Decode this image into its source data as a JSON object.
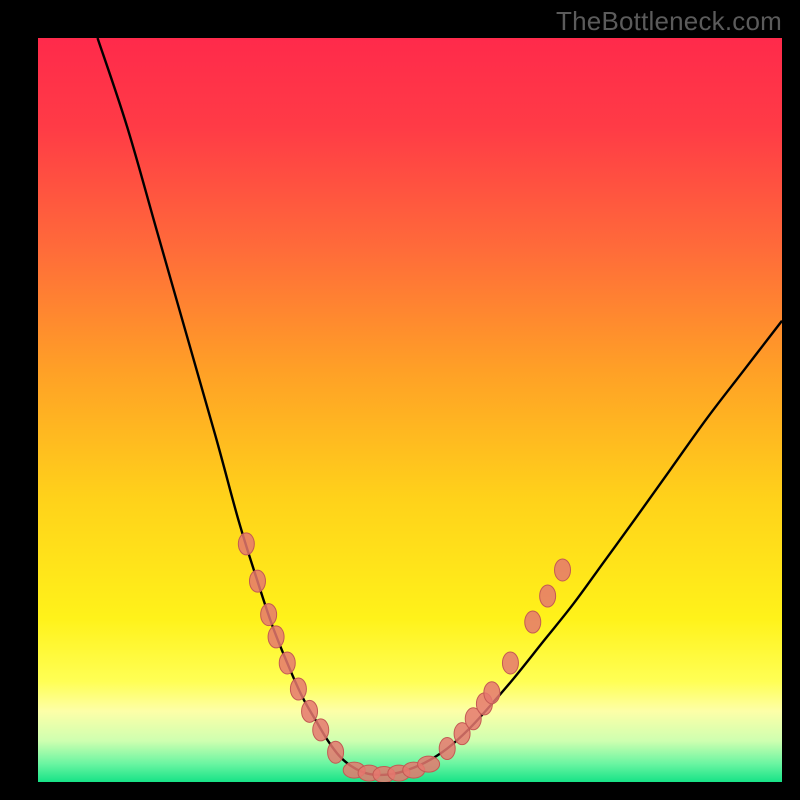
{
  "watermark": "TheBottleneck.com",
  "colors": {
    "black": "#000000",
    "curve": "#000000",
    "dot_fill": "#e5786f",
    "dot_stroke": "#c35a54",
    "gradient_stops": [
      {
        "offset": 0.0,
        "color": "#ff2a4b"
      },
      {
        "offset": 0.12,
        "color": "#ff3b46"
      },
      {
        "offset": 0.28,
        "color": "#ff6a3a"
      },
      {
        "offset": 0.45,
        "color": "#ffa126"
      },
      {
        "offset": 0.62,
        "color": "#ffd21a"
      },
      {
        "offset": 0.78,
        "color": "#fff21a"
      },
      {
        "offset": 0.865,
        "color": "#ffff55"
      },
      {
        "offset": 0.905,
        "color": "#fdffa8"
      },
      {
        "offset": 0.945,
        "color": "#ceffb0"
      },
      {
        "offset": 0.975,
        "color": "#6cf5a2"
      },
      {
        "offset": 1.0,
        "color": "#17e387"
      }
    ]
  },
  "chart_data": {
    "type": "line",
    "title": "",
    "xlabel": "",
    "ylabel": "",
    "xlim": [
      0,
      100
    ],
    "ylim": [
      0,
      100
    ],
    "grid": false,
    "legend": false,
    "series": [
      {
        "name": "bottleneck-curve",
        "x": [
          8,
          12,
          16,
          20,
          24,
          27,
          29.5,
          31.5,
          33.5,
          35.5,
          37.5,
          39,
          40.5,
          42,
          43.5,
          45,
          47,
          49,
          52,
          55,
          58,
          61,
          64,
          68,
          72,
          76,
          80,
          85,
          90,
          95,
          100
        ],
        "y": [
          100,
          88,
          74,
          60,
          46,
          35,
          27,
          21,
          16,
          11.5,
          8,
          5.5,
          3.5,
          2.2,
          1.4,
          1.0,
          1.0,
          1.4,
          2.6,
          4.5,
          7.2,
          10.5,
          14,
          19,
          24,
          29.5,
          35,
          42,
          49,
          55.5,
          62
        ]
      }
    ],
    "points_left": [
      {
        "x": 28.0,
        "y": 32.0
      },
      {
        "x": 29.5,
        "y": 27.0
      },
      {
        "x": 31.0,
        "y": 22.5
      },
      {
        "x": 32.0,
        "y": 19.5
      },
      {
        "x": 33.5,
        "y": 16.0
      },
      {
        "x": 35.0,
        "y": 12.5
      },
      {
        "x": 36.5,
        "y": 9.5
      },
      {
        "x": 38.0,
        "y": 7.0
      },
      {
        "x": 40.0,
        "y": 4.0
      }
    ],
    "points_bottom": [
      {
        "x": 42.5,
        "y": 1.6
      },
      {
        "x": 44.5,
        "y": 1.2
      },
      {
        "x": 46.5,
        "y": 1.0
      },
      {
        "x": 48.5,
        "y": 1.2
      },
      {
        "x": 50.5,
        "y": 1.6
      },
      {
        "x": 52.5,
        "y": 2.4
      }
    ],
    "points_right": [
      {
        "x": 55.0,
        "y": 4.5
      },
      {
        "x": 57.0,
        "y": 6.5
      },
      {
        "x": 58.5,
        "y": 8.5
      },
      {
        "x": 60.0,
        "y": 10.5
      },
      {
        "x": 61.0,
        "y": 12.0
      },
      {
        "x": 63.5,
        "y": 16.0
      },
      {
        "x": 66.5,
        "y": 21.5
      },
      {
        "x": 68.5,
        "y": 25.0
      },
      {
        "x": 70.5,
        "y": 28.5
      }
    ]
  }
}
